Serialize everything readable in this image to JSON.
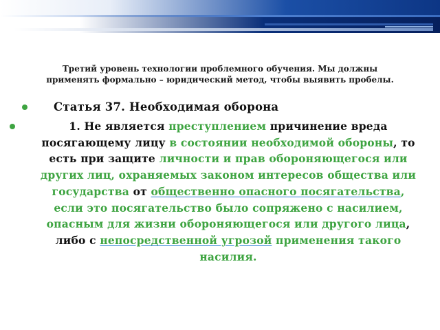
{
  "slide": {
    "title_line1": "Третий уровень технологии проблемного обучения. Мы должны",
    "title_line2": "применять формально – юридический метод, чтобы выявить пробелы."
  },
  "content": {
    "heading": "Статья 37. Необходимая оборона",
    "paragraph": {
      "p1": "1. Не является ",
      "p2": "преступлением",
      "p3": " причинение вреда посягающему лицу ",
      "p4": "в состоянии необходимой обороны",
      "p5": ", то есть при защите ",
      "p6": "личности и прав обороняющегося или других лиц, охраняемых законом интересов общества или государства",
      "p7": " от ",
      "p8": "общественно опасного посягательства",
      "p9": ", ",
      "p10": "если это посягательство было сопряжено с насилием, опасным для жизни обороняющегося или другого лица",
      "p11": ", либо с ",
      "p12": "непосредственной угрозой",
      "p13": " ",
      "p14": "применения такого насилия."
    }
  },
  "colors": {
    "accent_green": "#3ea441",
    "band_blue": "#0a2f7a",
    "text": "#111111"
  }
}
